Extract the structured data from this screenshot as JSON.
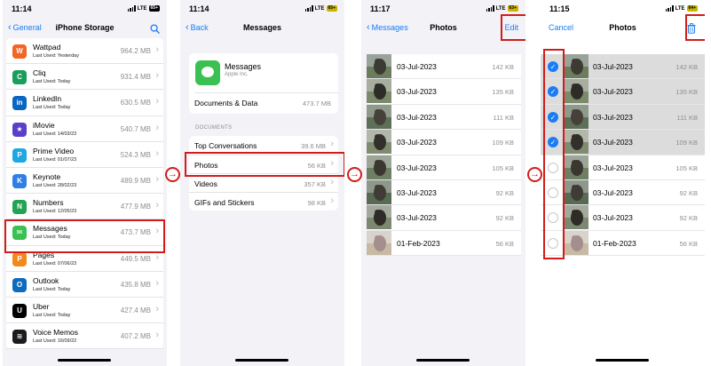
{
  "arrow_glyph": "→",
  "screens": {
    "storage": {
      "time": "11:14",
      "network": "LTE",
      "battery": "65+",
      "back_label": "General",
      "title": "iPhone Storage",
      "search_icon": "search-icon",
      "apps": [
        {
          "name": "Wattpad",
          "last_used": "Last Used: Yesterday",
          "size": "964.2 MB",
          "color": "#f26522",
          "glyph": "W"
        },
        {
          "name": "Cliq",
          "last_used": "Last Used: Today",
          "size": "931.4 MB",
          "color": "#1a9e5c",
          "glyph": "C"
        },
        {
          "name": "LinkedIn",
          "last_used": "Last Used: Today",
          "size": "630.5 MB",
          "color": "#0a66c2",
          "glyph": "in"
        },
        {
          "name": "iMovie",
          "last_used": "Last Used: 14/03/23",
          "size": "540.7 MB",
          "color": "#5b3fc9",
          "glyph": "★"
        },
        {
          "name": "Prime Video",
          "last_used": "Last Used: 01/07/23",
          "size": "524.3 MB",
          "color": "#1ea7e1",
          "glyph": "P"
        },
        {
          "name": "Keynote",
          "last_used": "Last Used: 28/02/23",
          "size": "489.9 MB",
          "color": "#2f7fe6",
          "glyph": "K"
        },
        {
          "name": "Numbers",
          "last_used": "Last Used: 12/05/23",
          "size": "477.9 MB",
          "color": "#23a455",
          "glyph": "N"
        },
        {
          "name": "Messages",
          "last_used": "Last Used: Today",
          "size": "473.7 MB",
          "color": "#3ac152",
          "glyph": "✉"
        },
        {
          "name": "Pages",
          "last_used": "Last Used: 07/06/23",
          "size": "449.5 MB",
          "color": "#f28a1a",
          "glyph": "P"
        },
        {
          "name": "Outlook",
          "last_used": "Last Used: Today",
          "size": "435.8 MB",
          "color": "#0f6cbd",
          "glyph": "O"
        },
        {
          "name": "Uber",
          "last_used": "Last Used: Today",
          "size": "427.4 MB",
          "color": "#000000",
          "glyph": "U"
        },
        {
          "name": "Voice Memos",
          "last_used": "Last Used: 16/09/22",
          "size": "407.2 MB",
          "color": "#1c1c1e",
          "glyph": "≋"
        }
      ]
    },
    "messages": {
      "time": "11:14",
      "network": "LTE",
      "battery": "65+",
      "back_label": "Back",
      "title": "Messages",
      "app_name": "Messages",
      "developer": "Apple Inc.",
      "docs_label": "Documents & Data",
      "docs_size": "473.7 MB",
      "section_header": "DOCUMENTS",
      "rows": [
        {
          "label": "Top Conversations",
          "size": "39.6 MB"
        },
        {
          "label": "Photos",
          "size": "56 KB"
        },
        {
          "label": "Videos",
          "size": "357 KB"
        },
        {
          "label": "GIFs and Stickers",
          "size": "98 KB"
        }
      ]
    },
    "photos": {
      "time": "11:17",
      "network": "LTE",
      "battery": "63+",
      "back_label": "Messages",
      "title": "Photos",
      "edit_label": "Edit",
      "items": [
        {
          "date": "03-Jul-2023",
          "size": "142 KB"
        },
        {
          "date": "03-Jul-2023",
          "size": "135 KB"
        },
        {
          "date": "03-Jul-2023",
          "size": "111 KB"
        },
        {
          "date": "03-Jul-2023",
          "size": "109 KB"
        },
        {
          "date": "03-Jul-2023",
          "size": "105 KB"
        },
        {
          "date": "03-Jul-2023",
          "size": "92 KB"
        },
        {
          "date": "03-Jul-2023",
          "size": "92 KB"
        },
        {
          "date": "01-Feb-2023",
          "size": "56 KB"
        }
      ]
    },
    "photos_edit": {
      "time": "11:15",
      "network": "LTE",
      "battery": "64+",
      "cancel_label": "Cancel",
      "title": "Photos",
      "trash_icon": "trash-icon",
      "items": [
        {
          "date": "03-Jul-2023",
          "size": "142 KB",
          "selected": true
        },
        {
          "date": "03-Jul-2023",
          "size": "135 KB",
          "selected": true
        },
        {
          "date": "03-Jul-2023",
          "size": "111 KB",
          "selected": true
        },
        {
          "date": "03-Jul-2023",
          "size": "109 KB",
          "selected": true
        },
        {
          "date": "03-Jul-2023",
          "size": "105 KB",
          "selected": false
        },
        {
          "date": "03-Jul-2023",
          "size": "92 KB",
          "selected": false
        },
        {
          "date": "03-Jul-2023",
          "size": "92 KB",
          "selected": false
        },
        {
          "date": "01-Feb-2023",
          "size": "56 KB",
          "selected": false
        }
      ]
    }
  },
  "colors": {
    "accent": "#1a7cf5",
    "highlight": "#d21c1c",
    "selected_row": "#dcdcdc"
  }
}
